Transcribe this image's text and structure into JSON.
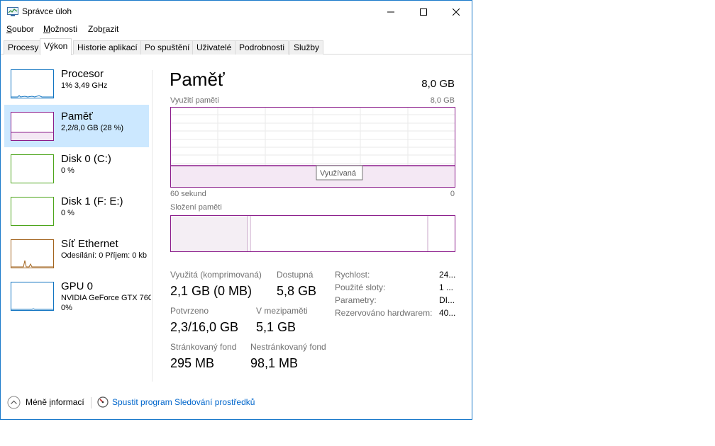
{
  "window": {
    "title": "Správce úloh",
    "controls": {
      "minimize": "minimize-icon",
      "maximize": "maximize-icon",
      "close": "close-icon"
    }
  },
  "menu": [
    {
      "label": "Soubor",
      "access_key": "S"
    },
    {
      "label": "Možnosti",
      "access_key": "M"
    },
    {
      "label": "Zobrazit",
      "access_key": "r"
    }
  ],
  "tabs": [
    {
      "label": "Procesy",
      "active": false
    },
    {
      "label": "Výkon",
      "active": true
    },
    {
      "label": "Historie aplikací",
      "active": false
    },
    {
      "label": "Po spuštění",
      "active": false
    },
    {
      "label": "Uživatelé",
      "active": false
    },
    {
      "label": "Podrobnosti",
      "active": false
    },
    {
      "label": "Služby",
      "active": false
    }
  ],
  "sidebar": {
    "items": [
      {
        "title": "Procesor",
        "sub": "1%  3,49 GHz",
        "sub2": "",
        "color": "#1174c1",
        "selected": false
      },
      {
        "title": "Paměť",
        "sub": "2,2/8,0 GB (28 %)",
        "sub2": "",
        "color": "#8b1c8b",
        "selected": true
      },
      {
        "title": "Disk 0 (C:)",
        "sub": "0 %",
        "sub2": "",
        "color": "#4da51b",
        "selected": false
      },
      {
        "title": "Disk 1 (F: E:)",
        "sub": "0 %",
        "sub2": "",
        "color": "#4da51b",
        "selected": false
      },
      {
        "title": "Síť Ethernet",
        "sub": "Odesílání: 0 Příjem: 0 kb",
        "sub2": "",
        "color": "#a2631d",
        "selected": false
      },
      {
        "title": "GPU 0",
        "sub": "NVIDIA GeForce GTX 760",
        "sub2": "0%",
        "color": "#1174c1",
        "selected": false
      }
    ]
  },
  "main": {
    "title": "Paměť",
    "total": "8,0 GB",
    "usage_label": "Využití paměti",
    "usage_max": "8,0 GB",
    "usage_fraction": 0.28,
    "time_left": "60 sekund",
    "time_right": "0",
    "tooltip": "Využívaná",
    "composition_label": "Složení paměti",
    "composition": {
      "in_use_fraction": 0.27,
      "modified_fraction": 0.005,
      "standby_fraction": 0.63
    },
    "accent_color": "#8b1c8b",
    "stats": [
      {
        "label": "Využitá (komprimovaná)",
        "value": "2,1 GB (0 MB)"
      },
      {
        "label": "Dostupná",
        "value": "5,8 GB"
      },
      {
        "label": "Potvrzeno",
        "value": "2,3/16,0 GB"
      },
      {
        "label": "V mezipaměti",
        "value": "5,1 GB"
      },
      {
        "label": "Stránkovaný fond",
        "value": "295 MB"
      },
      {
        "label": "Nestránkovaný fond",
        "value": "98,1 MB"
      }
    ],
    "info": [
      {
        "label": "Rychlost:",
        "value": "24..."
      },
      {
        "label": "Použité sloty:",
        "value": "1 ..."
      },
      {
        "label": "Parametry:",
        "value": "DI..."
      },
      {
        "label": "Rezervováno hardwarem:",
        "value": "40..."
      }
    ]
  },
  "footer": {
    "less_info": "Méně informací",
    "less_info_access_key": "i",
    "monitor_link": "Spustit program Sledování prostředků"
  }
}
